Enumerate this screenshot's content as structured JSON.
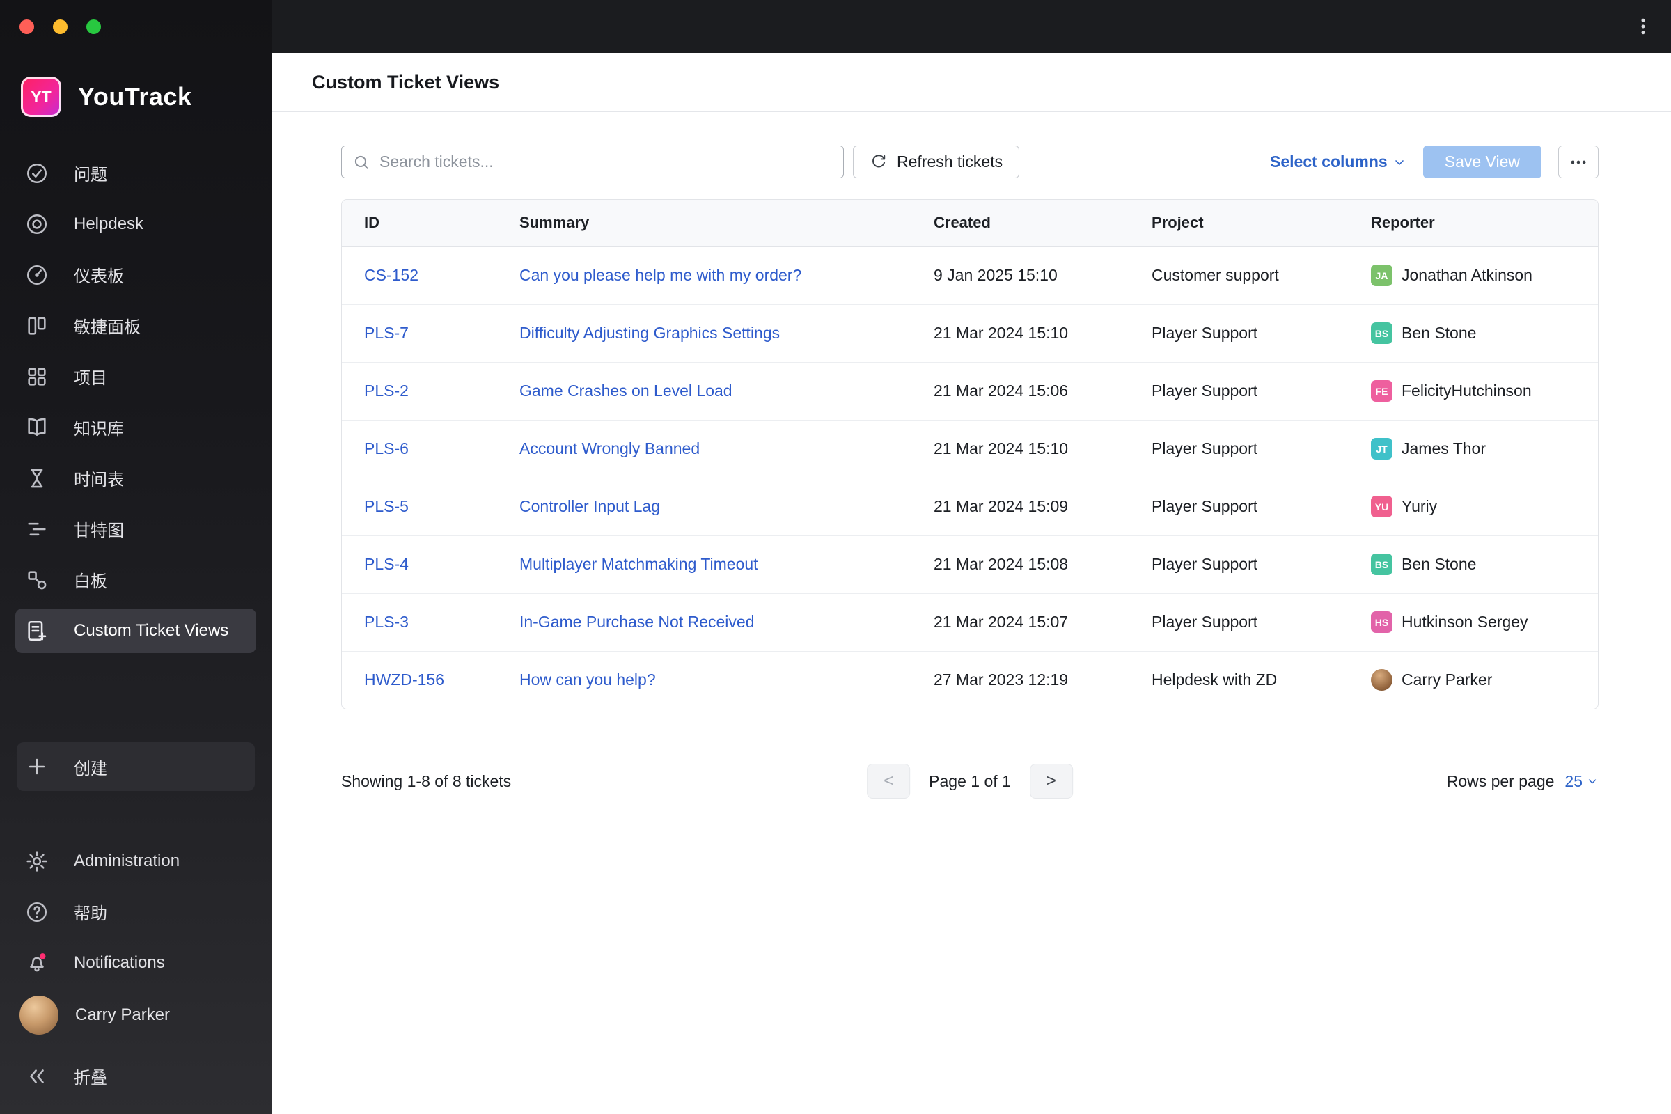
{
  "sidebar": {
    "logo_badge": "YT",
    "logo_text": "YouTrack",
    "items": [
      {
        "name": "issues",
        "label": "问题",
        "icon": "issues-icon",
        "selected": false
      },
      {
        "name": "helpdesk",
        "label": "Helpdesk",
        "icon": "helpdesk-icon",
        "selected": false
      },
      {
        "name": "dashboards",
        "label": "仪表板",
        "icon": "dashboards-icon",
        "selected": false
      },
      {
        "name": "agile-boards",
        "label": "敏捷面板",
        "icon": "agile-icon",
        "selected": false
      },
      {
        "name": "projects",
        "label": "项目",
        "icon": "projects-icon",
        "selected": false
      },
      {
        "name": "knowledge-base",
        "label": "知识库",
        "icon": "kb-icon",
        "selected": false
      },
      {
        "name": "timesheets",
        "label": "时间表",
        "icon": "timesheet-icon",
        "selected": false
      },
      {
        "name": "gantt-charts",
        "label": "甘特图",
        "icon": "gantt-icon",
        "selected": false
      },
      {
        "name": "whiteboards",
        "label": "白板",
        "icon": "whiteboard-icon",
        "selected": false
      },
      {
        "name": "custom-ticket-views",
        "label": "Custom Ticket Views",
        "icon": "ticket-views-icon",
        "selected": true
      }
    ],
    "create_label": "创建",
    "bottom_items": [
      {
        "name": "administration",
        "label": "Administration",
        "icon": "gear-icon"
      },
      {
        "name": "help",
        "label": "帮助",
        "icon": "help-icon"
      },
      {
        "name": "notifications",
        "label": "Notifications",
        "icon": "bell-icon"
      }
    ],
    "user_name": "Carry Parker",
    "collapse_label": "折叠"
  },
  "header": {
    "title": "Custom Ticket Views"
  },
  "toolbar": {
    "search_placeholder": "Search tickets...",
    "refresh_label": "Refresh tickets",
    "select_columns_label": "Select columns",
    "save_view_label": "Save View"
  },
  "table": {
    "columns": [
      "ID",
      "Summary",
      "Created",
      "Project",
      "Reporter"
    ],
    "rows": [
      {
        "id": "CS-152",
        "summary": "Can you please help me with my order?",
        "created": "9 Jan 2025 15:10",
        "project": "Customer support",
        "reporter": "Jonathan Atkinson",
        "initials": "JA",
        "avatar_color": "#7cc26b"
      },
      {
        "id": "PLS-7",
        "summary": "Difficulty Adjusting Graphics Settings",
        "created": "21 Mar 2024 15:10",
        "project": "Player Support",
        "reporter": "Ben Stone",
        "initials": "BS",
        "avatar_color": "#45c4a0"
      },
      {
        "id": "PLS-2",
        "summary": "Game Crashes on Level Load",
        "created": "21 Mar 2024 15:06",
        "project": "Player Support",
        "reporter": "FelicityHutchinson",
        "initials": "FE",
        "avatar_color": "#ee5f9e"
      },
      {
        "id": "PLS-6",
        "summary": "Account Wrongly Banned",
        "created": "21 Mar 2024 15:10",
        "project": "Player Support",
        "reporter": "James Thor",
        "initials": "JT",
        "avatar_color": "#3fc1c9"
      },
      {
        "id": "PLS-5",
        "summary": "Controller Input Lag",
        "created": "21 Mar 2024 15:09",
        "project": "Player Support",
        "reporter": "Yuriy",
        "initials": "YU",
        "avatar_color": "#f0608f"
      },
      {
        "id": "PLS-4",
        "summary": "Multiplayer Matchmaking Timeout",
        "created": "21 Mar 2024 15:08",
        "project": "Player Support",
        "reporter": "Ben Stone",
        "initials": "BS",
        "avatar_color": "#45c4a0"
      },
      {
        "id": "PLS-3",
        "summary": "In-Game Purchase Not Received",
        "created": "21 Mar 2024 15:07",
        "project": "Player Support",
        "reporter": "Hutkinson Sergey",
        "initials": "HS",
        "avatar_color": "#e263a9"
      },
      {
        "id": "HWZD-156",
        "summary": "How can you help?",
        "created": "27 Mar 2023 12:19",
        "project": "Helpdesk with ZD",
        "reporter": "Carry Parker",
        "initials": "",
        "avatar_color": "photo"
      }
    ]
  },
  "footer": {
    "showing": "Showing 1-8 of 8 tickets",
    "prev": "<",
    "page": "Page 1 of 1",
    "next": ">",
    "rows_per_page_label": "Rows per page",
    "rows_per_page_value": "25"
  }
}
